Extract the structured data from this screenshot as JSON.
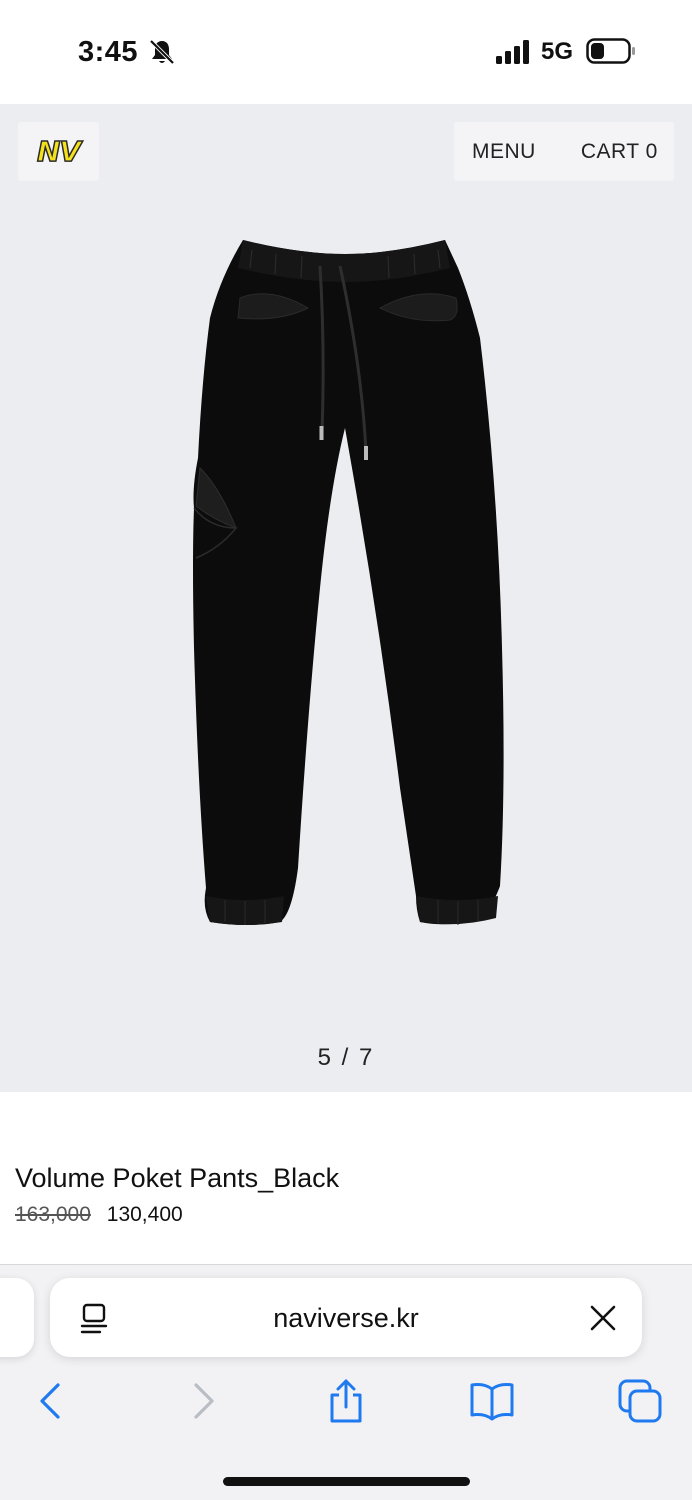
{
  "status_bar": {
    "time": "3:45",
    "network": "5G",
    "icons": [
      "bell-slash-icon",
      "signal-icon",
      "battery-icon"
    ]
  },
  "header": {
    "logo": "NV",
    "menu_label": "MENU",
    "cart_label": "CART 0"
  },
  "gallery": {
    "pager": "5 / 7",
    "image_icon": "pants-image"
  },
  "product": {
    "name": "Volume Poket Pants_Black",
    "original_price": "163,000",
    "sale_price": "130,400"
  },
  "browser": {
    "url": "naviverse.kr",
    "icons": [
      "reader-icon",
      "close-icon",
      "back-icon",
      "forward-icon",
      "share-icon",
      "bookmarks-icon",
      "tabs-icon"
    ]
  },
  "colors": {
    "accent_blue": "#1f7af0",
    "logo_yellow": "#f5e11b",
    "hero_bg": "#ecedf1"
  }
}
